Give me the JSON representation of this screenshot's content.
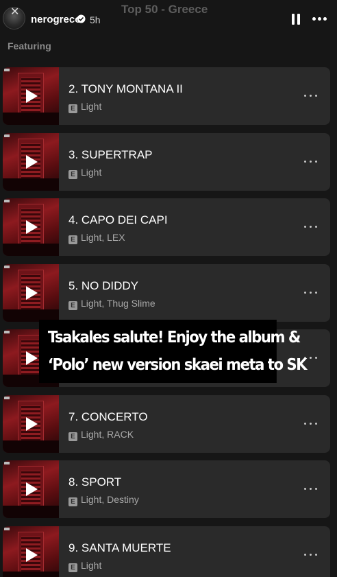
{
  "story": {
    "username": "nerogreco",
    "time": "5h",
    "playlist_title": "Top 50 - Greece",
    "section_label": "Featuring",
    "caption_line1": "Tsakales salute! Enjoy the album &",
    "caption_line2": "‘Polo’ new version skaei meta to SK"
  },
  "tracks": [
    {
      "title": "2. TONY MONTANA II",
      "artists": "Light",
      "explicit": "E"
    },
    {
      "title": "3. SUPERTRAP",
      "artists": "Light",
      "explicit": "E"
    },
    {
      "title": "4. CAPO DEI CAPI",
      "artists": "Light, LEX",
      "explicit": "E"
    },
    {
      "title": "5. NO DIDDY",
      "artists": "Light, Thug Slime",
      "explicit": "E"
    },
    {
      "title": "",
      "artists": "",
      "explicit": ""
    },
    {
      "title": "7. CONCERTO",
      "artists": "Light, RACK",
      "explicit": "E"
    },
    {
      "title": "8. SPORT",
      "artists": "Light, Destiny",
      "explicit": "E"
    },
    {
      "title": "9. SANTA MUERTE",
      "artists": "Light",
      "explicit": "E"
    }
  ],
  "icons": {
    "verified": "verified-badge-icon",
    "pause": "pause-icon",
    "more": "more-options-icon",
    "play": "play-icon"
  },
  "colors": {
    "background": "#161616",
    "card": "#2a2a2a",
    "muted_text": "#a9a9a9",
    "cover_red": "#8d1a1f"
  }
}
